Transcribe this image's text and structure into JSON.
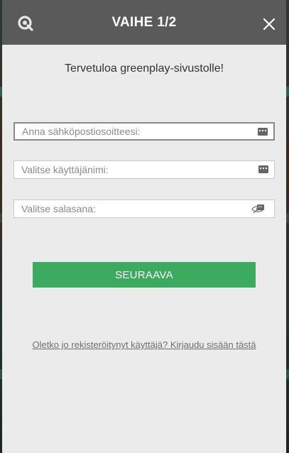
{
  "modal": {
    "title": "VAIHE 1/2",
    "welcome": "Tervetuloa greenplay-sivustolle!",
    "fields": {
      "email_placeholder": "Anna sähköpostiosoitteesi:",
      "username_placeholder": "Valitse käyttäjänimi:",
      "password_placeholder": "Valitse salasana:"
    },
    "next_label": "SEURAAVA",
    "login_link": "Oletko jo rekisteröitynyt käyttäjä? Kirjaudu sisään tästä"
  },
  "colors": {
    "header_bg": "#5a5a5a",
    "button_green": "#3dab5f",
    "modal_bg": "#ebebeb"
  },
  "icons": {
    "logo": "greenplay-logo-icon",
    "close": "close-icon",
    "keyboard": "keyboard-icon",
    "eye": "eye-slash-icon"
  }
}
